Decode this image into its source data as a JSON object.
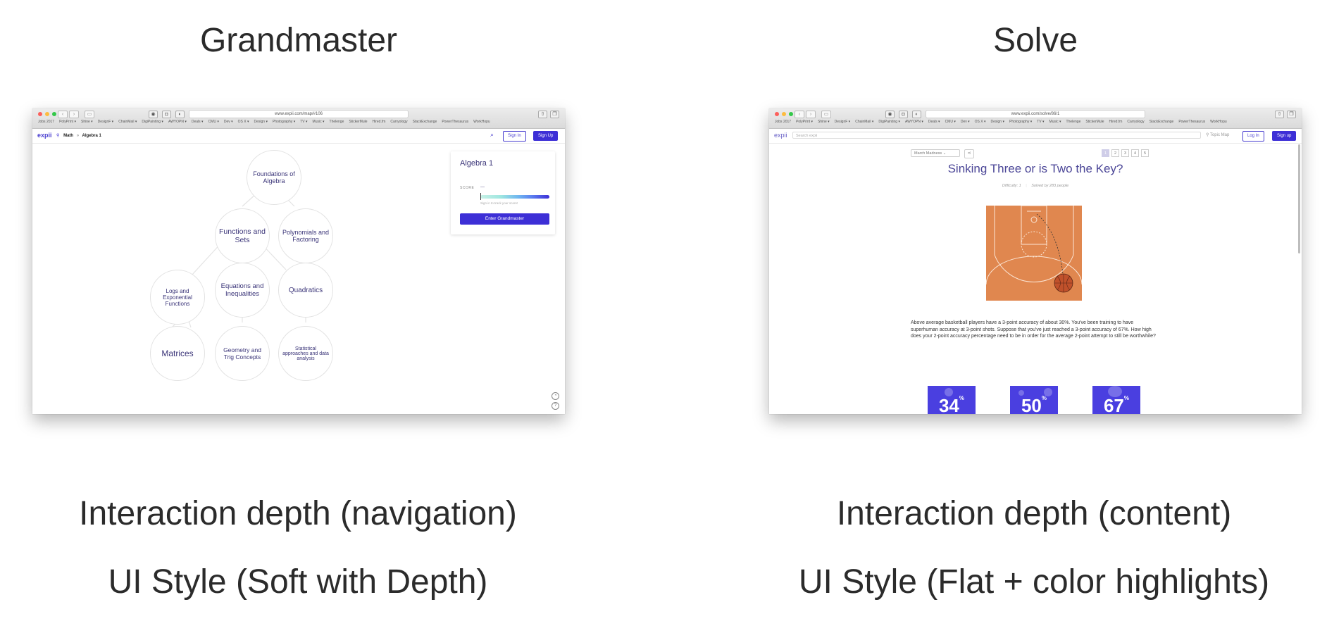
{
  "left": {
    "heading": "Grandmaster",
    "caption1": "Interaction depth (navigation)",
    "caption2": "UI Style (Soft with Depth)",
    "url": "www.expii.com/map/#106",
    "bookmarks": [
      "Jobs 2017",
      "PolyPrint ▾",
      "Shine ▾",
      "DesignF ▾",
      "ChainMail ▾",
      "DigiPainting ▾",
      "AWYOPN ▾",
      "Deals ▾",
      "CMU ▾",
      "Dev ▾",
      "OS X ▾",
      "Design ▾",
      "Photography ▾",
      "TV ▾",
      "Music ▾",
      "Thelenge",
      "StickerMule",
      "Hired.fm",
      "Carryology",
      "StackExchange",
      "PowerThesaurus",
      "WorkHopu"
    ],
    "logo": "expii",
    "crumb_math": "Math",
    "crumb_sep": "»",
    "crumb_topic": "Algebra 1",
    "sign_in": "Sign In",
    "sign_up": "Sign Up",
    "nodes": [
      "Foundations of Algebra",
      "Functions and Sets",
      "Polynomials and Factoring",
      "Logs and Exponential Functions",
      "Equations and Inequalities",
      "Quadratics",
      "Matrices",
      "Geometry and Trig Concepts",
      "Statistical approaches and data analysis"
    ],
    "card": {
      "title": "Algebra 1",
      "score_label": "SCORE",
      "score_value": "---",
      "hint": "Sign in to track your score!",
      "button": "Enter Grandmaster"
    }
  },
  "right": {
    "heading": "Solve",
    "caption1": "Interaction depth (content)",
    "caption2": "UI Style (Flat + color highlights)",
    "url": "www.expii.com/solve/86/1",
    "logo": "expii",
    "search_placeholder": "Search expii",
    "topic_map": "Topic Map",
    "log_in": "Log In",
    "sign_up": "Sign up",
    "dropdown": "March Madness",
    "pages": [
      "1",
      "2",
      "3",
      "4",
      "5"
    ],
    "question_title": "Sinking Three or is Two the Key?",
    "difficulty": "Difficulty: 1",
    "solved_by": "Solved by 283 people",
    "problem": "Above average basketball players have a 3-point accuracy of about 30%. You've been training to have superhuman accuracy at 3-point shots. Suppose that you've just reached a 3-point accuracy of 67%. How high does your 2-point accuracy percentage need to be in order for the average 2-point attempt to still be worthwhile?",
    "options": [
      "34",
      "50",
      "67"
    ],
    "percent_sign": "%"
  },
  "colors": {
    "accent": "#3d2fd6",
    "court": "#e0874f",
    "node_text": "#3a3478"
  }
}
